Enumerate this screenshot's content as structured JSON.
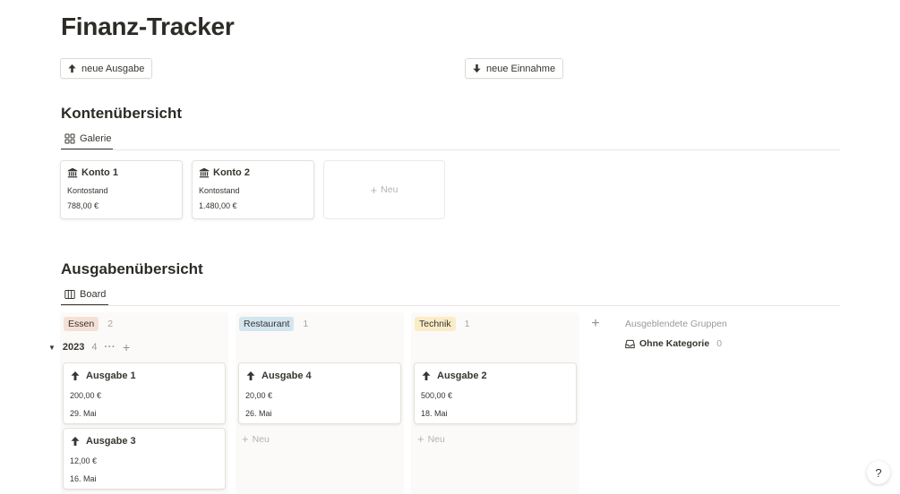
{
  "page": {
    "title": "Finanz-Tracker"
  },
  "actions": {
    "new_expense": "neue Ausgabe",
    "new_income": "neue Einnahme"
  },
  "accounts_section": {
    "title": "Kontenübersicht",
    "view_tab": "Galerie",
    "cards": [
      {
        "name": "Konto 1",
        "label": "Kontostand",
        "value": "788,00 €"
      },
      {
        "name": "Konto 2",
        "label": "Kontostand",
        "value": "1.480,00 €"
      }
    ],
    "new_label": "Neu"
  },
  "expenses_section": {
    "title": "Ausgabenübersicht",
    "view_tab": "Board",
    "groups": [
      {
        "name": "Essen",
        "count": "2",
        "color": "#f5e0d5"
      },
      {
        "name": "Restaurant",
        "count": "1",
        "color": "#d3e5ef"
      },
      {
        "name": "Technik",
        "count": "1",
        "color": "#fbecc8"
      }
    ],
    "hidden_groups_label": "Ausgeblendete Gruppen",
    "no_category": {
      "label": "Ohne Kategorie",
      "count": "0"
    },
    "sub_group": {
      "year": "2023",
      "count": "4"
    },
    "cards": {
      "essen": [
        {
          "name": "Ausgabe 1",
          "amount": "200,00 €",
          "date": "29. Mai"
        },
        {
          "name": "Ausgabe 3",
          "amount": "12,00 €",
          "date": "16. Mai"
        }
      ],
      "restaurant": [
        {
          "name": "Ausgabe 4",
          "amount": "20,00 €",
          "date": "26. Mai"
        }
      ],
      "technik": [
        {
          "name": "Ausgabe 2",
          "amount": "500,00 €",
          "date": "18. Mai"
        }
      ]
    },
    "new_label": "Neu"
  },
  "help": {
    "label": "?"
  },
  "icons": {
    "arrow_up": "arrow-up-icon",
    "arrow_down": "arrow-down-icon",
    "gallery": "gallery-icon",
    "board": "board-icon",
    "bank": "bank-icon",
    "inbox": "inbox-icon"
  }
}
